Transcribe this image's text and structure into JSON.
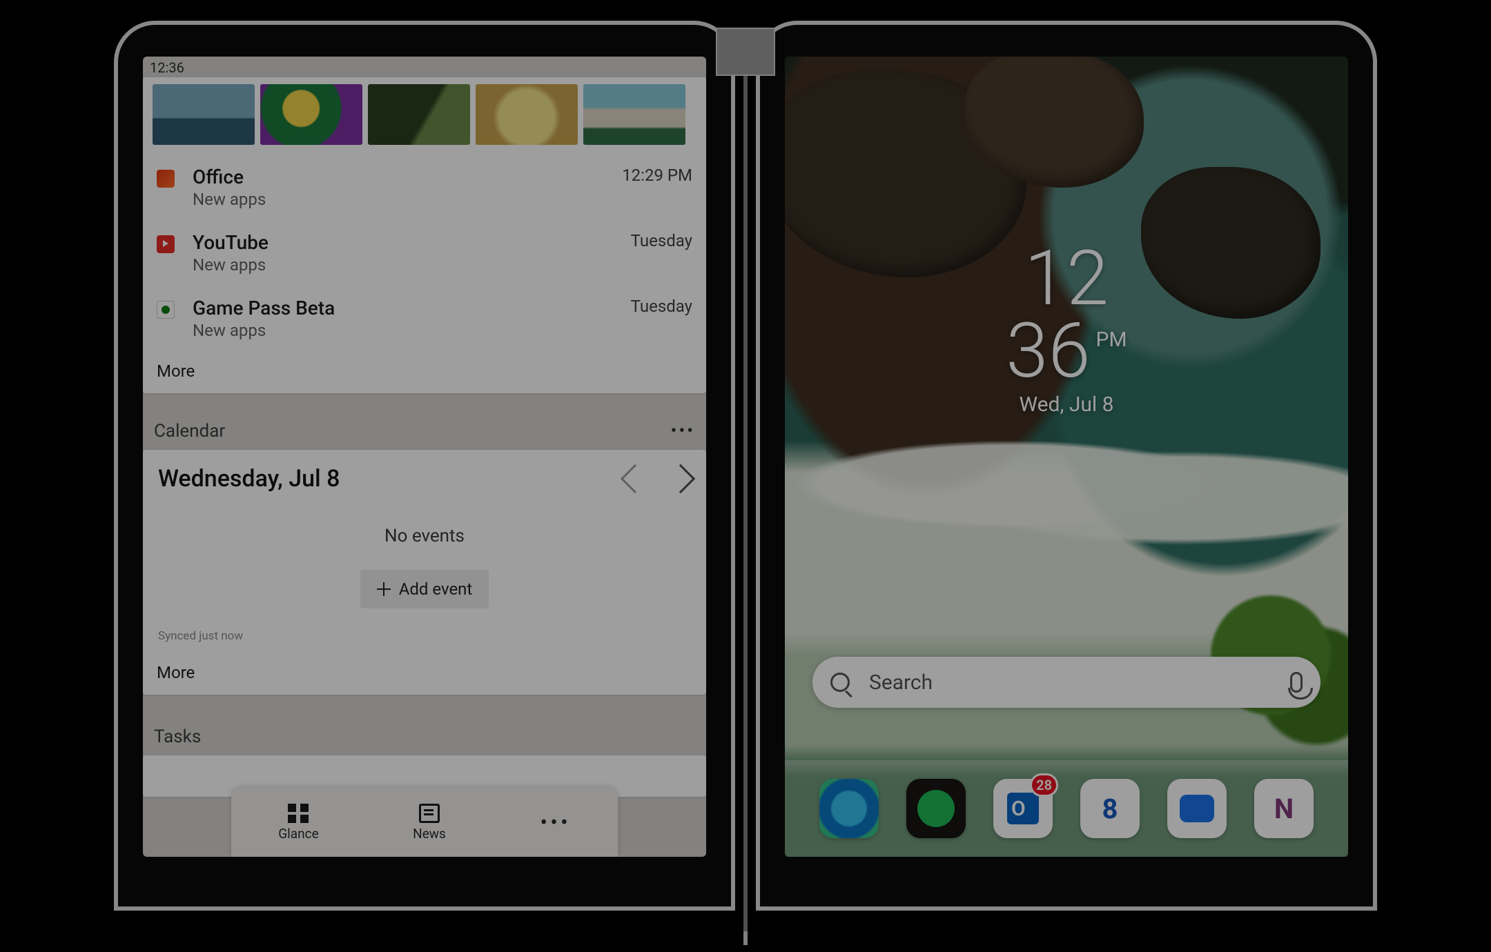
{
  "status_bar": {
    "time": "12:36"
  },
  "feed": {
    "items": [
      {
        "title": "Office",
        "subtitle": "New apps",
        "time": "12:29 PM",
        "icon": "office-icon"
      },
      {
        "title": "YouTube",
        "subtitle": "New apps",
        "time": "Tuesday",
        "icon": "youtube-icon"
      },
      {
        "title": "Game Pass Beta",
        "subtitle": "New apps",
        "time": "Tuesday",
        "icon": "gamepass-icon"
      }
    ],
    "more_label": "More"
  },
  "calendar": {
    "section_title": "Calendar",
    "date_label": "Wednesday, Jul 8",
    "no_events_label": "No events",
    "add_event_label": "Add event",
    "synced_label": "Synced just now",
    "more_label": "More"
  },
  "tasks": {
    "section_title": "Tasks"
  },
  "bottom_nav": {
    "glance_label": "Glance",
    "news_label": "News"
  },
  "home": {
    "clock_hour": "12",
    "clock_minute": "36",
    "clock_ampm": "PM",
    "clock_date": "Wed, Jul 8",
    "search_placeholder": "Search"
  },
  "dock": {
    "outlook_badge": "28"
  }
}
